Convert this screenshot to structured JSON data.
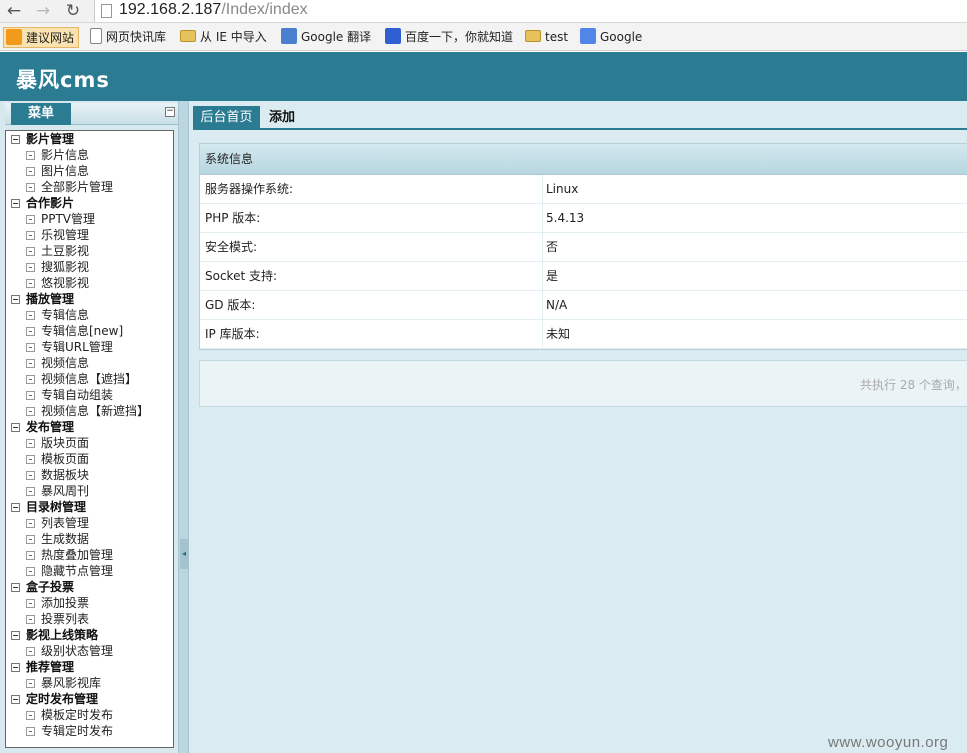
{
  "browser": {
    "url_host": "192.168.2.187",
    "url_path": "/Index/index",
    "nav": {
      "back": "←",
      "forward": "→",
      "reload": "↻"
    },
    "bookmarks": [
      {
        "label": "建议网站",
        "icon": "bulb-icon"
      },
      {
        "label": "网页快讯库",
        "icon": "page-icon"
      },
      {
        "label": "从 IE 中导入",
        "icon": "folder-icon"
      },
      {
        "label": "Google 翻译",
        "icon": "translate-icon"
      },
      {
        "label": "百度一下，你就知道",
        "icon": "baidu-icon"
      },
      {
        "label": "test",
        "icon": "folder-icon"
      },
      {
        "label": "Google",
        "icon": "google-icon"
      }
    ]
  },
  "app": {
    "title": "暴风cms"
  },
  "sidebar": {
    "tab_label": "菜单",
    "collapse": "−",
    "groups": [
      {
        "title": "影片管理",
        "items": [
          "影片信息",
          "图片信息",
          "全部影片管理"
        ]
      },
      {
        "title": "合作影片",
        "items": [
          "PPTV管理",
          "乐视管理",
          "土豆影视",
          "搜狐影视",
          "悠视影视"
        ]
      },
      {
        "title": "播放管理",
        "items": [
          "专辑信息",
          "专辑信息[new]",
          "专辑URL管理",
          "视频信息",
          "视频信息【遮挡】",
          "专辑自动组装",
          "视频信息【新遮挡】"
        ]
      },
      {
        "title": "发布管理",
        "items": [
          "版块页面",
          "模板页面",
          "数据板块",
          "暴风周刊"
        ]
      },
      {
        "title": "目录树管理",
        "items": [
          "列表管理",
          "生成数据",
          "热度叠加管理",
          "隐藏节点管理"
        ]
      },
      {
        "title": "盒子投票",
        "items": [
          "添加投票",
          "投票列表"
        ]
      },
      {
        "title": "影视上线策略",
        "items": [
          "级别状态管理"
        ]
      },
      {
        "title": "推荐管理",
        "items": [
          "暴风影视库"
        ]
      },
      {
        "title": "定时发布管理",
        "items": [
          "模板定时发布",
          "专辑定时发布"
        ]
      }
    ]
  },
  "splitter": {
    "arrow": "◂"
  },
  "main": {
    "tabs": [
      {
        "label": "后台首页"
      },
      {
        "label": "添加"
      }
    ],
    "panel_title": "系统信息",
    "rows": [
      {
        "key": "服务器操作系统:",
        "value": "Linux"
      },
      {
        "key": "PHP 版本:",
        "value": "5.4.13"
      },
      {
        "key": "安全模式:",
        "value": "否"
      },
      {
        "key": "Socket 支持:",
        "value": "是"
      },
      {
        "key": "GD 版本:",
        "value": "N/A"
      },
      {
        "key": "IP 库版本:",
        "value": "未知"
      }
    ],
    "footer": "共执行 28 个查询，"
  },
  "watermark": "www.wooyun.org"
}
